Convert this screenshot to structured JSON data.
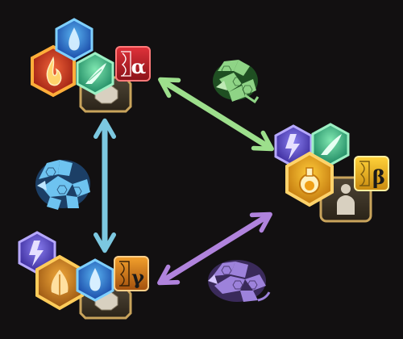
{
  "nodes": {
    "alpha": {
      "label": "α",
      "hexes": [
        "water-element",
        "fire-element",
        "wind-element",
        "wild-slot"
      ],
      "badge": "helix-hourglass",
      "colors": {
        "frame": "#d9572a",
        "badge": "#c8202a"
      }
    },
    "beta": {
      "label": "β",
      "hexes": [
        "lightning-element",
        "wind-element",
        "potion-element",
        "humanoid-slot"
      ],
      "badge": "helix-hourglass",
      "colors": {
        "frame": "#e8a21e",
        "badge": "#f2c21c"
      }
    },
    "gamma": {
      "label": "γ",
      "hexes": [
        "lightning-element",
        "earth-element",
        "water-element",
        "wild-slot"
      ],
      "badge": "helix-hourglass",
      "colors": {
        "frame": "#e8a21e",
        "badge": "#e6891c"
      }
    }
  },
  "links": [
    {
      "from": "alpha",
      "to": "beta",
      "color": "#9ddf8c",
      "emblem": "griffin"
    },
    {
      "from": "alpha",
      "to": "gamma",
      "color": "#7cc8e0",
      "emblem": "winged-lion"
    },
    {
      "from": "beta",
      "to": "gamma",
      "color": "#b083dd",
      "emblem": "dragon"
    }
  ]
}
